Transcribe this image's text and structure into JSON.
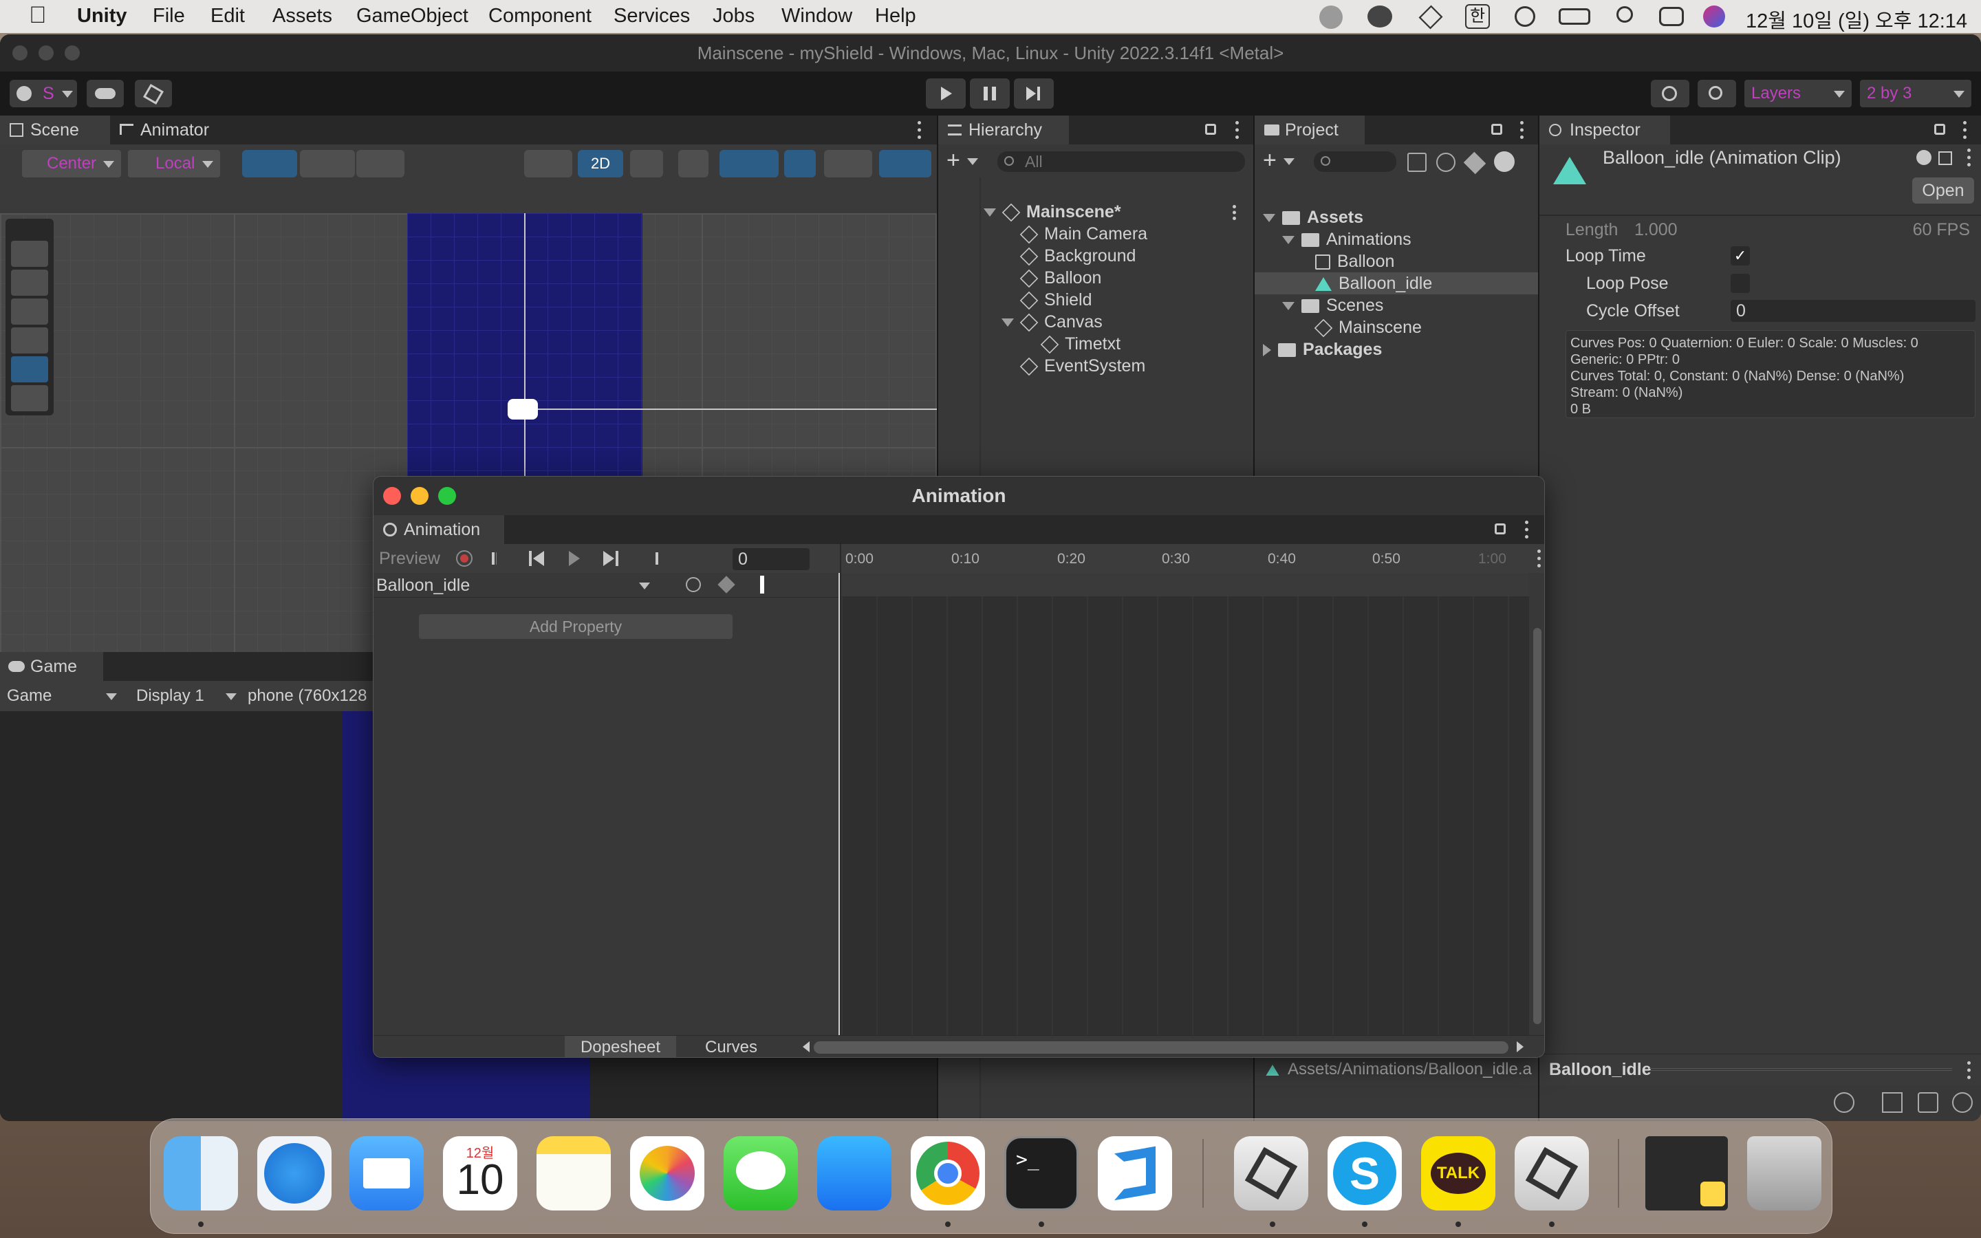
{
  "menubar": {
    "items": [
      "Unity",
      "File",
      "Edit",
      "Assets",
      "GameObject",
      "Component",
      "Services",
      "Jobs",
      "Window",
      "Help"
    ],
    "clock": "12월 10일 (일) 오후 12:14",
    "ime": "한"
  },
  "window": {
    "title": "Mainscene - myShield - Windows, Mac, Linux - Unity 2022.3.14f1 <Metal>"
  },
  "toolbar": {
    "account": "S",
    "layers": "Layers",
    "layout": "2 by 3"
  },
  "scene": {
    "tab": "Scene",
    "animator_tab": "Animator",
    "pivot": "Center",
    "space": "Local",
    "mode2d": "2D"
  },
  "game": {
    "tab": "Game",
    "view": "Game",
    "display": "Display 1",
    "resolution": "phone (760x128"
  },
  "hierarchy": {
    "tab": "Hierarchy",
    "search_placeholder": "All",
    "scene_name": "Mainscene*",
    "items": [
      "Main Camera",
      "Background",
      "Balloon",
      "Shield",
      "Canvas"
    ],
    "canvas_child": "Timetxt",
    "last_item": "EventSystem"
  },
  "project": {
    "tab": "Project",
    "assets": "Assets",
    "animations": "Animations",
    "balloon": "Balloon",
    "balloon_idle": "Balloon_idle",
    "scenes": "Scenes",
    "mainscene": "Mainscene",
    "packages": "Packages",
    "path": "Assets/Animations/Balloon_idle.a"
  },
  "inspector": {
    "tab": "Inspector",
    "title": "Balloon_idle (Animation Clip)",
    "open_button": "Open",
    "length_label": "Length",
    "length_value": "1.000",
    "fps": "60 FPS",
    "loop_time": "Loop Time",
    "loop_pose": "Loop Pose",
    "cycle_offset": "Cycle Offset",
    "cycle_offset_value": "0",
    "info_lines": [
      "Curves Pos: 0 Quaternion: 0 Euler: 0 Scale: 0 Muscles: 0",
      "Generic: 0 PPtr: 0",
      "Curves Total: 0, Constant: 0 (NaN%) Dense: 0 (NaN%)",
      "Stream: 0 (NaN%)",
      "0 B"
    ],
    "preview_label": "Balloon_idle"
  },
  "animation": {
    "window_title": "Animation",
    "tab": "Animation",
    "preview": "Preview",
    "frame": "0",
    "clip": "Balloon_idle",
    "add_property": "Add Property",
    "ticks": [
      "0:00",
      "0:10",
      "0:20",
      "0:30",
      "0:40",
      "0:50",
      "1:00"
    ],
    "dopesheet": "Dopesheet",
    "curves": "Curves"
  },
  "dock": {
    "calendar_month": "12월",
    "calendar_day": "10",
    "kakao": "TALK"
  },
  "colors": {
    "accent_blue": "#2c5d87",
    "scene_bg": "#1a1a6e",
    "magenta": "#c040c0"
  }
}
